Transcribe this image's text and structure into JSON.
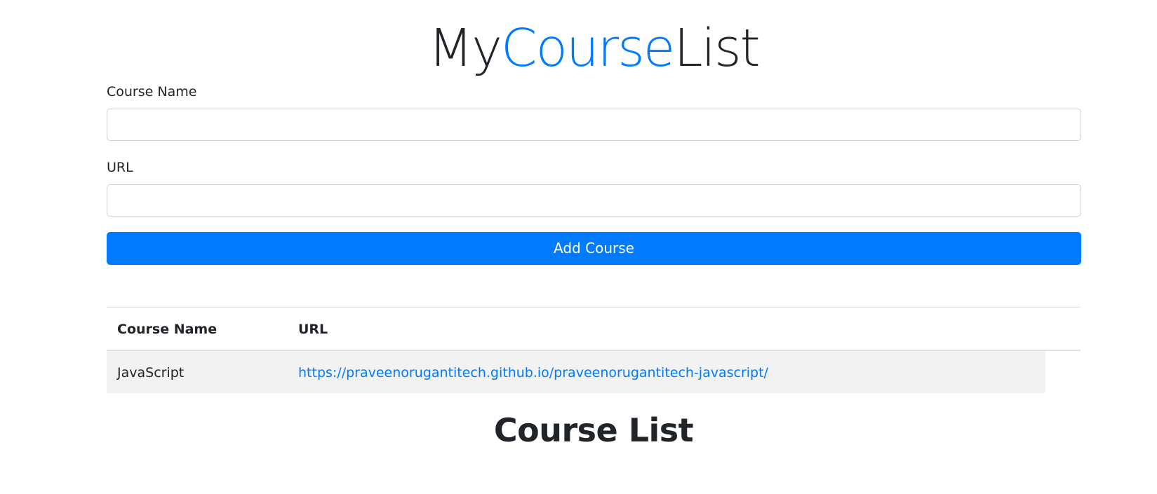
{
  "header": {
    "title_part1": "My",
    "title_part2": "Course",
    "title_part3": "List",
    "accent_color": "#007bff"
  },
  "form": {
    "course_name_label": "Course Name",
    "course_name_value": "",
    "url_label": "URL",
    "url_value": "",
    "submit_label": "Add Course",
    "button_color": "#007bff"
  },
  "table": {
    "columns": [
      "Course Name",
      "URL"
    ],
    "rows": [
      {
        "course_name": "JavaScript",
        "url": "https://praveenorugantitech.github.io/praveenorugantitech-javascript/"
      }
    ]
  },
  "section_heading": "Course List"
}
